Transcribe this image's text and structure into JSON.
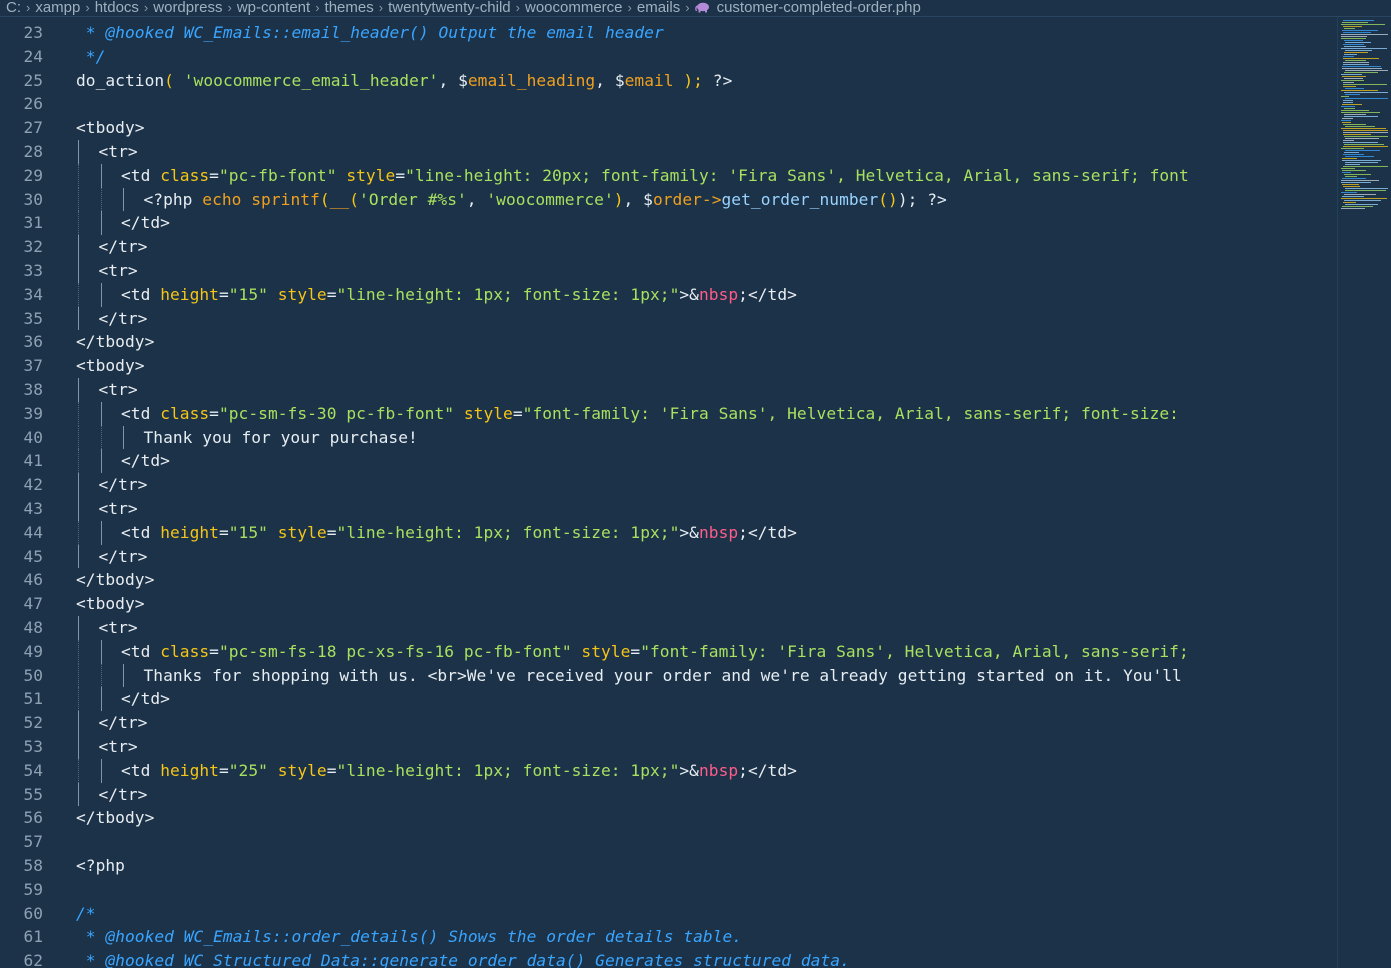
{
  "breadcrumb": {
    "items": [
      "C:",
      "xampp",
      "htdocs",
      "wordpress",
      "wp-content",
      "themes",
      "twentytwenty-child",
      "woocommerce",
      "emails"
    ],
    "file": "customer-completed-order.php",
    "file_icon": "php-elephant-icon"
  },
  "editor": {
    "lines": [
      {
        "n": "23",
        "indent": 0,
        "tokens": [
          [
            "com",
            " * @hooked WC_Emails::email_header() Output the email header"
          ]
        ]
      },
      {
        "n": "24",
        "indent": 0,
        "tokens": [
          [
            "com",
            " */"
          ]
        ]
      },
      {
        "n": "25",
        "indent": 0,
        "tokens": [
          [
            "plain",
            "do_action"
          ],
          [
            "punc",
            "( "
          ],
          [
            "str",
            "'woocommerce_email_header'"
          ],
          [
            "plain",
            ", "
          ],
          [
            "plain",
            "$"
          ],
          [
            "var",
            "email_heading"
          ],
          [
            "plain",
            ", "
          ],
          [
            "plain",
            "$"
          ],
          [
            "var",
            "email"
          ],
          [
            "punc",
            " ); "
          ],
          [
            "plain",
            "?>"
          ]
        ]
      },
      {
        "n": "26",
        "indent": 0,
        "tokens": []
      },
      {
        "n": "27",
        "indent": 0,
        "tokens": [
          [
            "tag",
            "<tbody>"
          ]
        ]
      },
      {
        "n": "28",
        "indent": 1,
        "tokens": [
          [
            "tag",
            "<tr>"
          ]
        ]
      },
      {
        "n": "29",
        "indent": 2,
        "tokens": [
          [
            "tag",
            "<td "
          ],
          [
            "attr",
            "class"
          ],
          [
            "plain",
            "="
          ],
          [
            "str",
            "\"pc-fb-font\""
          ],
          [
            "plain",
            " "
          ],
          [
            "attr",
            "style"
          ],
          [
            "plain",
            "="
          ],
          [
            "str",
            "\"line-height: 20px; font-family: 'Fira Sans', Helvetica, Arial, sans-serif; font"
          ]
        ]
      },
      {
        "n": "30",
        "indent": 3,
        "tokens": [
          [
            "plain",
            "<?php "
          ],
          [
            "kw",
            "echo "
          ],
          [
            "kw",
            "sprintf"
          ],
          [
            "punc",
            "("
          ],
          [
            "kw",
            "__"
          ],
          [
            "punc",
            "("
          ],
          [
            "str",
            "'Order #%s'"
          ],
          [
            "plain",
            ", "
          ],
          [
            "str",
            "'woocommerce'"
          ],
          [
            "punc",
            ")"
          ],
          [
            "plain",
            ", $"
          ],
          [
            "var",
            "order"
          ],
          [
            "kw",
            "->"
          ],
          [
            "fn",
            "get_order_number"
          ],
          [
            "punc",
            "()"
          ],
          [
            "plain",
            "); ?>"
          ]
        ]
      },
      {
        "n": "31",
        "indent": 2,
        "tokens": [
          [
            "tag",
            "</td>"
          ]
        ]
      },
      {
        "n": "32",
        "indent": 1,
        "tokens": [
          [
            "tag",
            "</tr>"
          ]
        ]
      },
      {
        "n": "33",
        "indent": 1,
        "tokens": [
          [
            "tag",
            "<tr>"
          ]
        ]
      },
      {
        "n": "34",
        "indent": 2,
        "tokens": [
          [
            "tag",
            "<td "
          ],
          [
            "attr",
            "height"
          ],
          [
            "plain",
            "="
          ],
          [
            "str",
            "\"15\""
          ],
          [
            "plain",
            " "
          ],
          [
            "attr",
            "style"
          ],
          [
            "plain",
            "="
          ],
          [
            "str",
            "\"line-height: 1px; font-size: 1px;\""
          ],
          [
            "plain",
            ">&"
          ],
          [
            "ent",
            "nbsp"
          ],
          [
            "plain",
            ";"
          ],
          [
            "tag",
            "</td>"
          ]
        ]
      },
      {
        "n": "35",
        "indent": 1,
        "tokens": [
          [
            "tag",
            "</tr>"
          ]
        ]
      },
      {
        "n": "36",
        "indent": 0,
        "tokens": [
          [
            "tag",
            "</tbody>"
          ]
        ]
      },
      {
        "n": "37",
        "indent": 0,
        "tokens": [
          [
            "tag",
            "<tbody>"
          ]
        ]
      },
      {
        "n": "38",
        "indent": 1,
        "tokens": [
          [
            "tag",
            "<tr>"
          ]
        ]
      },
      {
        "n": "39",
        "indent": 2,
        "tokens": [
          [
            "tag",
            "<td "
          ],
          [
            "attr",
            "class"
          ],
          [
            "plain",
            "="
          ],
          [
            "str",
            "\"pc-sm-fs-30 pc-fb-font\""
          ],
          [
            "plain",
            " "
          ],
          [
            "attr",
            "style"
          ],
          [
            "plain",
            "="
          ],
          [
            "str",
            "\"font-family: 'Fira Sans', Helvetica, Arial, sans-serif; font-size:"
          ]
        ]
      },
      {
        "n": "40",
        "indent": 3,
        "tokens": [
          [
            "plain",
            "Thank you for your purchase!"
          ]
        ]
      },
      {
        "n": "41",
        "indent": 2,
        "tokens": [
          [
            "tag",
            "</td>"
          ]
        ]
      },
      {
        "n": "42",
        "indent": 1,
        "tokens": [
          [
            "tag",
            "</tr>"
          ]
        ]
      },
      {
        "n": "43",
        "indent": 1,
        "tokens": [
          [
            "tag",
            "<tr>"
          ]
        ]
      },
      {
        "n": "44",
        "indent": 2,
        "tokens": [
          [
            "tag",
            "<td "
          ],
          [
            "attr",
            "height"
          ],
          [
            "plain",
            "="
          ],
          [
            "str",
            "\"15\""
          ],
          [
            "plain",
            " "
          ],
          [
            "attr",
            "style"
          ],
          [
            "plain",
            "="
          ],
          [
            "str",
            "\"line-height: 1px; font-size: 1px;\""
          ],
          [
            "plain",
            ">&"
          ],
          [
            "ent",
            "nbsp"
          ],
          [
            "plain",
            ";"
          ],
          [
            "tag",
            "</td>"
          ]
        ]
      },
      {
        "n": "45",
        "indent": 1,
        "tokens": [
          [
            "tag",
            "</tr>"
          ]
        ]
      },
      {
        "n": "46",
        "indent": 0,
        "tokens": [
          [
            "tag",
            "</tbody>"
          ]
        ]
      },
      {
        "n": "47",
        "indent": 0,
        "tokens": [
          [
            "tag",
            "<tbody>"
          ]
        ]
      },
      {
        "n": "48",
        "indent": 1,
        "tokens": [
          [
            "tag",
            "<tr>"
          ]
        ]
      },
      {
        "n": "49",
        "indent": 2,
        "tokens": [
          [
            "tag",
            "<td "
          ],
          [
            "attr",
            "class"
          ],
          [
            "plain",
            "="
          ],
          [
            "str",
            "\"pc-sm-fs-18 pc-xs-fs-16 pc-fb-font\""
          ],
          [
            "plain",
            " "
          ],
          [
            "attr",
            "style"
          ],
          [
            "plain",
            "="
          ],
          [
            "str",
            "\"font-family: 'Fira Sans', Helvetica, Arial, sans-serif;"
          ]
        ]
      },
      {
        "n": "50",
        "indent": 3,
        "tokens": [
          [
            "plain",
            "Thanks for shopping with us. "
          ],
          [
            "tag",
            "<br>"
          ],
          [
            "plain",
            "We've received your order and we're already getting started on it. You'll"
          ]
        ]
      },
      {
        "n": "51",
        "indent": 2,
        "tokens": [
          [
            "tag",
            "</td>"
          ]
        ]
      },
      {
        "n": "52",
        "indent": 1,
        "tokens": [
          [
            "tag",
            "</tr>"
          ]
        ]
      },
      {
        "n": "53",
        "indent": 1,
        "tokens": [
          [
            "tag",
            "<tr>"
          ]
        ]
      },
      {
        "n": "54",
        "indent": 2,
        "tokens": [
          [
            "tag",
            "<td "
          ],
          [
            "attr",
            "height"
          ],
          [
            "plain",
            "="
          ],
          [
            "str",
            "\"25\""
          ],
          [
            "plain",
            " "
          ],
          [
            "attr",
            "style"
          ],
          [
            "plain",
            "="
          ],
          [
            "str",
            "\"line-height: 1px; font-size: 1px;\""
          ],
          [
            "plain",
            ">&"
          ],
          [
            "ent",
            "nbsp"
          ],
          [
            "plain",
            ";"
          ],
          [
            "tag",
            "</td>"
          ]
        ]
      },
      {
        "n": "55",
        "indent": 1,
        "tokens": [
          [
            "tag",
            "</tr>"
          ]
        ]
      },
      {
        "n": "56",
        "indent": 0,
        "tokens": [
          [
            "tag",
            "</tbody>"
          ]
        ]
      },
      {
        "n": "57",
        "indent": 0,
        "tokens": []
      },
      {
        "n": "58",
        "indent": 0,
        "tokens": [
          [
            "plain",
            "<?php"
          ]
        ]
      },
      {
        "n": "59",
        "indent": 0,
        "tokens": []
      },
      {
        "n": "60",
        "indent": 0,
        "tokens": [
          [
            "com",
            "/*"
          ]
        ]
      },
      {
        "n": "61",
        "indent": 0,
        "tokens": [
          [
            "com",
            " * @hooked WC_Emails::order_details() Shows the order details table."
          ]
        ]
      },
      {
        "n": "62",
        "indent": 0,
        "tokens": [
          [
            "com",
            " * @hooked WC_Structured_Data::generate_order_data() Generates structured data."
          ]
        ]
      }
    ]
  },
  "colors": {
    "background": "#1b3248",
    "comment": "#3aa5ff",
    "string": "#a8e05f",
    "attribute": "#f5c518",
    "keyword": "#f0a020",
    "entity": "#ff5c8a"
  }
}
